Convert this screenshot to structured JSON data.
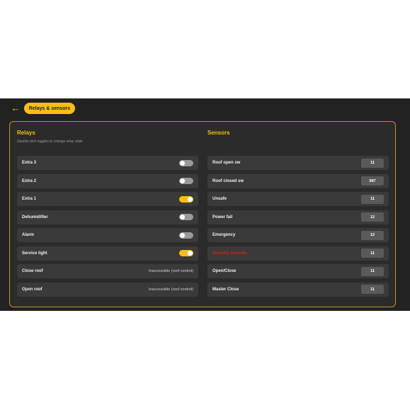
{
  "header": {
    "back_icon": "arrow-left-icon",
    "crumb": "Relays & sensors"
  },
  "relays": {
    "title": "Relays",
    "subtitle": "Double-click toggles to change relay state",
    "items": [
      {
        "label": "Extra 3",
        "type": "toggle",
        "on": false
      },
      {
        "label": "Extra 2",
        "type": "toggle",
        "on": false
      },
      {
        "label": "Extra 1",
        "type": "toggle",
        "on": true
      },
      {
        "label": "Dehumidifier",
        "type": "toggle",
        "on": false
      },
      {
        "label": "Alarm",
        "type": "toggle",
        "on": false
      },
      {
        "label": "Service light",
        "type": "toggle",
        "on": true
      },
      {
        "label": "Close roof",
        "type": "note",
        "note": "Inaccessible (roof control)"
      },
      {
        "label": "Open roof",
        "type": "note",
        "note": "Inaccessible (roof control)"
      }
    ]
  },
  "sensors": {
    "title": "Sensors",
    "items": [
      {
        "label": "Roof open sw",
        "value": "11"
      },
      {
        "label": "Roof closed sw",
        "value": "987"
      },
      {
        "label": "Unsafe",
        "value": "11"
      },
      {
        "label": "Power fail",
        "value": "12"
      },
      {
        "label": "Emergency",
        "value": "12"
      },
      {
        "label": "Security override",
        "value": "11",
        "alert": true
      },
      {
        "label": "Open/Close",
        "value": "11"
      },
      {
        "label": "Master Close",
        "value": "11"
      }
    ]
  },
  "colors": {
    "accent": "#f5bf16",
    "alert": "#d82020",
    "panel_border": "#d08a1d"
  }
}
